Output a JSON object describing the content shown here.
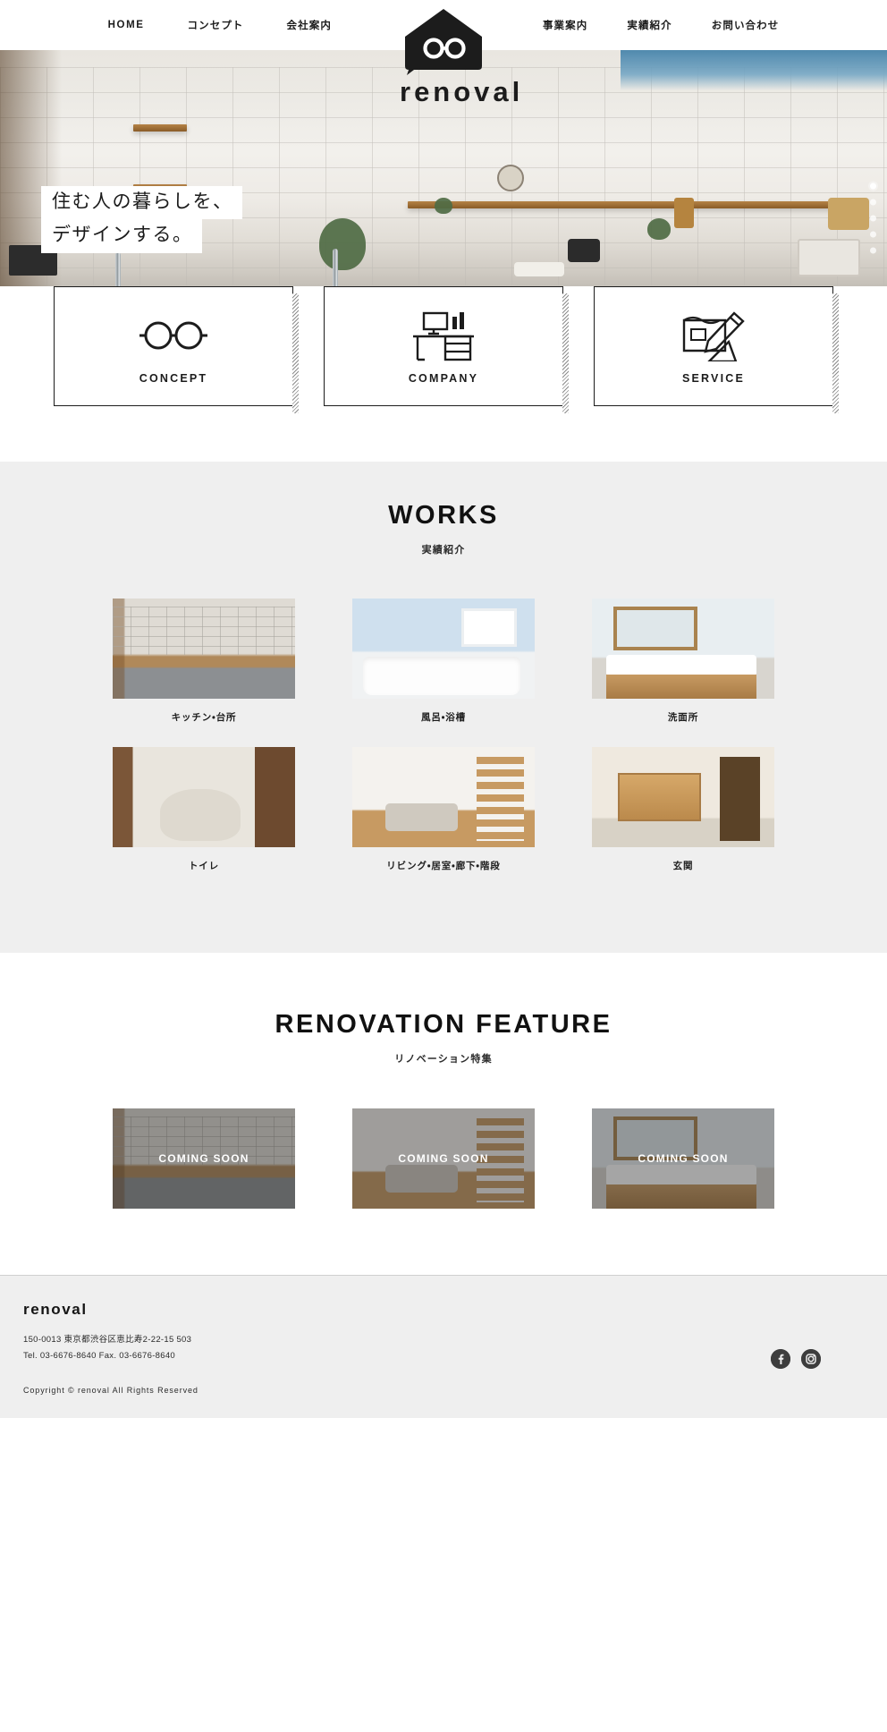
{
  "site": {
    "brand": "renoval",
    "logo_icon": "house-glasses-logo"
  },
  "nav": {
    "left": [
      {
        "label": "HOME",
        "name": "nav-home"
      },
      {
        "label": "コンセプト",
        "name": "nav-concept"
      },
      {
        "label": "会社案内",
        "name": "nav-company"
      }
    ],
    "right": [
      {
        "label": "事業案内",
        "name": "nav-service"
      },
      {
        "label": "実績紹介",
        "name": "nav-works"
      },
      {
        "label": "お問い合わせ",
        "name": "nav-contact"
      }
    ]
  },
  "hero": {
    "line1": "住む人の暮らしを、",
    "line2": "デザインする。",
    "slide_count": 5,
    "active_slide": 1
  },
  "cards": [
    {
      "label": "CONCEPT",
      "icon": "glasses-icon"
    },
    {
      "label": "COMPANY",
      "icon": "desk-computer-icon"
    },
    {
      "label": "SERVICE",
      "icon": "blueprint-pencil-icon"
    }
  ],
  "works": {
    "title": "WORKS",
    "subtitle": "実績紹介",
    "items": [
      {
        "caption": "キッチン・台所",
        "photo": "kitchen"
      },
      {
        "caption": "風呂・浴槽",
        "photo": "bath"
      },
      {
        "caption": "洗面所",
        "photo": "washroom"
      },
      {
        "caption": "トイレ",
        "photo": "toilet"
      },
      {
        "caption": "リビング・居室・廊下・階段",
        "photo": "living"
      },
      {
        "caption": "玄関",
        "photo": "entrance"
      }
    ]
  },
  "feature": {
    "title": "RENOVATION FEATURE",
    "subtitle": "リノベーション特集",
    "items": [
      {
        "label": "COMING SOON",
        "photo": "kitchen"
      },
      {
        "label": "COMING SOON",
        "photo": "living"
      },
      {
        "label": "COMING SOON",
        "photo": "washroom"
      }
    ]
  },
  "footer": {
    "logo": "renoval",
    "address": "150-0013 東京都渋谷区恵比寿2-22-15 503",
    "tel": "Tel. 03-6676-8640 Fax. 03-6676-8640",
    "copyright": "Copyright © renoval All Rights Reserved",
    "social": [
      {
        "name": "facebook-icon",
        "glyph": "f"
      },
      {
        "name": "instagram-icon",
        "glyph": ""
      }
    ]
  },
  "colors": {
    "ink": "#1c1c1c",
    "band": "#efefef",
    "white": "#ffffff"
  }
}
